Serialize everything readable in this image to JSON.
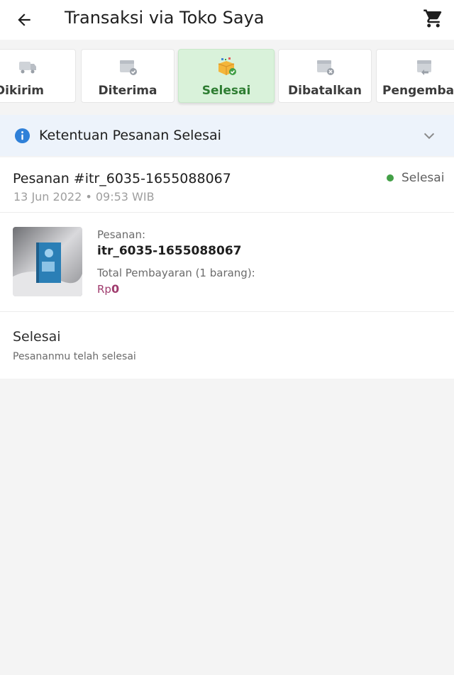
{
  "appbar": {
    "title": "Transaksi via Toko Saya",
    "back_icon": "arrow-left-icon",
    "cart_icon": "shopping-cart-icon"
  },
  "tabs": [
    {
      "label": "Dikirim",
      "icon": "truck-icon",
      "active": false
    },
    {
      "label": "Diterima",
      "icon": "package-received-icon",
      "active": false
    },
    {
      "label": "Selesai",
      "icon": "box-check-icon",
      "active": true
    },
    {
      "label": "Dibatalkan",
      "icon": "package-cancel-icon",
      "active": false
    },
    {
      "label": "Pengembalia",
      "icon": "package-return-icon",
      "active": false
    }
  ],
  "banner": {
    "text": "Ketentuan Pesanan Selesai",
    "icon": "info-icon",
    "expand_icon": "chevron-down-icon"
  },
  "order": {
    "id_text": "Pesanan #itr_6035-1655088067",
    "date": "13 Jun 2022 • 09:53 WIB",
    "status": "Selesai",
    "pesanan_label": "Pesanan:",
    "pesanan_value": "itr_6035-1655088067",
    "total_label": "Total Pembayaran (1 barang):",
    "total_currency": "Rp",
    "total_amount": "0",
    "done_title": "Selesai",
    "done_sub": "Pesananmu telah selesai"
  },
  "colors": {
    "accent_green": "#2e7d32",
    "status_dot": "#43a047",
    "info_blue": "#2f80d8",
    "price": "#a03c6e"
  }
}
